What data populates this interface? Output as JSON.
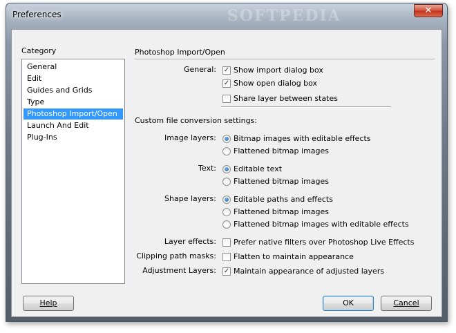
{
  "window": {
    "title": "Preferences",
    "watermark": "SOFTPEDIA",
    "close_glyph": "✕"
  },
  "category": {
    "label": "Category",
    "items": [
      "General",
      "Edit",
      "Guides and Grids",
      "Type",
      "Photoshop Import/Open",
      "Launch And Edit",
      "Plug-Ins"
    ],
    "selected": "Photoshop Import/Open"
  },
  "section_title": "Photoshop Import/Open",
  "general": {
    "label": "General:",
    "options": [
      {
        "label": "Show import dialog box",
        "checked": true
      },
      {
        "label": "Show open dialog box",
        "checked": true
      },
      {
        "label": "Share layer between states",
        "checked": false
      }
    ]
  },
  "conversion_heading": "Custom file conversion settings:",
  "image_layers": {
    "label": "Image layers:",
    "options": [
      {
        "label": "Bitmap images with editable effects",
        "selected": true
      },
      {
        "label": "Flattened bitmap images",
        "selected": false
      }
    ]
  },
  "text": {
    "label": "Text:",
    "options": [
      {
        "label": "Editable text",
        "selected": true
      },
      {
        "label": "Flattened bitmap images",
        "selected": false
      }
    ]
  },
  "shape_layers": {
    "label": "Shape layers:",
    "options": [
      {
        "label": "Editable paths and effects",
        "selected": true
      },
      {
        "label": "Flattened bitmap images",
        "selected": false
      },
      {
        "label": "Flattened bitmap images with editable effects",
        "selected": false
      }
    ]
  },
  "layer_effects": {
    "label": "Layer effects:",
    "option": "Prefer native filters over Photoshop Live Effects",
    "checked": false
  },
  "clipping_path_masks": {
    "label": "Clipping path masks:",
    "option": "Flatten to maintain appearance",
    "checked": false
  },
  "adjustment_layers": {
    "label": "Adjustment Layers:",
    "option": "Maintain appearance of adjusted layers",
    "checked": true
  },
  "buttons": {
    "help": "Help",
    "ok": "OK",
    "cancel": "Cancel"
  },
  "icons": {
    "check_glyph": "✓"
  },
  "colors": {
    "selection": "#3399ff",
    "close_button": "#c2321c",
    "dialog_bg": "#f0f0f0"
  }
}
